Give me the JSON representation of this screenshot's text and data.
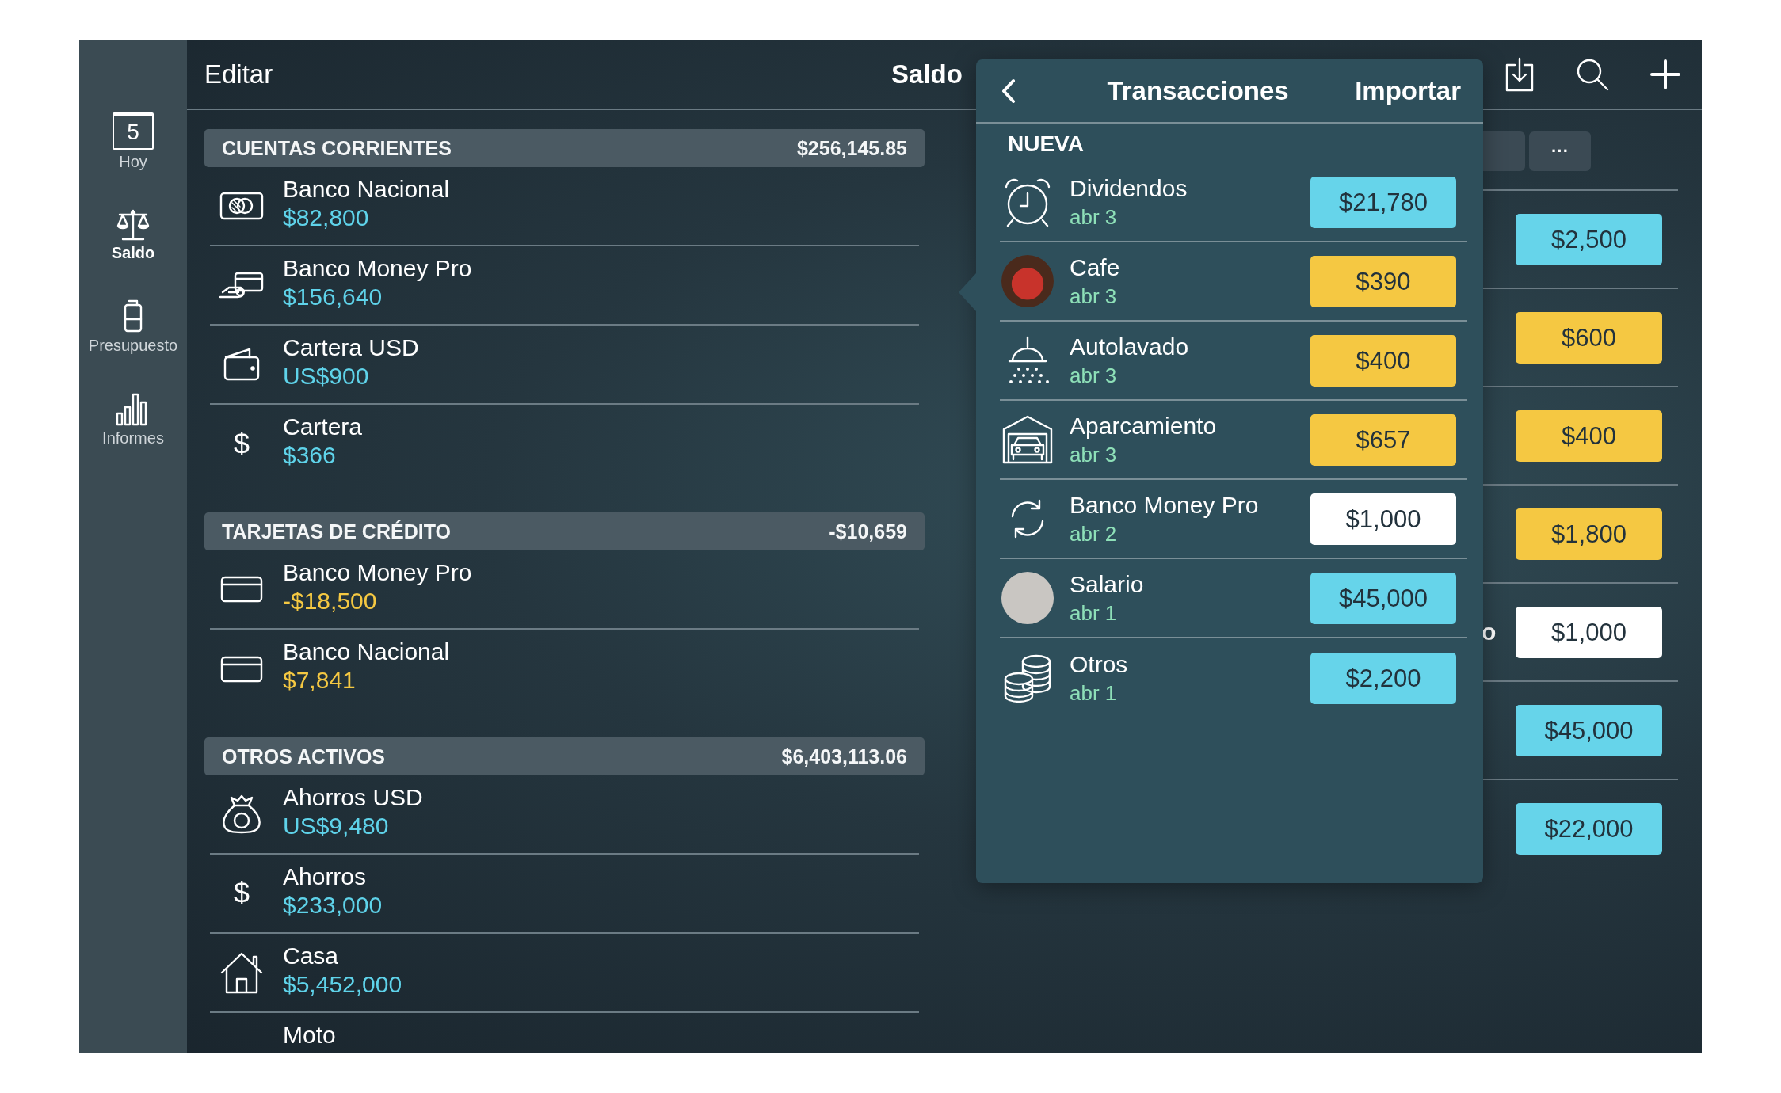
{
  "sidebar": {
    "items": [
      {
        "label": "Hoy",
        "kind": "calendar",
        "day": "5",
        "selected": false
      },
      {
        "label": "Saldo",
        "kind": "scales",
        "selected": true
      },
      {
        "label": "Presupuesto",
        "kind": "budget",
        "selected": false
      },
      {
        "label": "Informes",
        "kind": "bars",
        "selected": false
      }
    ]
  },
  "toolbar": {
    "edit": "Editar",
    "title": "Saldo"
  },
  "sections": [
    {
      "title": "CUENTAS CORRIENTES",
      "total": "$256,145.85",
      "accounts": [
        {
          "name": "Banco Nacional",
          "balance": "$82,800",
          "color": "#5fd3ea",
          "kind": "bank-card"
        },
        {
          "name": "Banco Money Pro",
          "balance": "$156,640",
          "color": "#5fd3ea",
          "kind": "card-hand"
        },
        {
          "name": "Cartera USD",
          "balance": "US$900",
          "color": "#5fd3ea",
          "kind": "wallet"
        },
        {
          "name": "Cartera",
          "balance": "$366",
          "color": "#5fd3ea",
          "kind": "symbol",
          "symbol": "$"
        }
      ]
    },
    {
      "title": "TARJETAS DE CRÉDITO",
      "total": "-$10,659",
      "accounts": [
        {
          "name": "Banco Money Pro",
          "balance": "-$18,500",
          "color": "#f5c842",
          "kind": "credit-card"
        },
        {
          "name": "Banco Nacional",
          "balance": "$7,841",
          "color": "#f5c842",
          "kind": "credit-card"
        }
      ]
    },
    {
      "title": "OTROS ACTIVOS",
      "total": "$6,403,113.06",
      "accounts": [
        {
          "name": "Ahorros USD",
          "balance": "US$9,480",
          "color": "#5fd3ea",
          "kind": "moneybag"
        },
        {
          "name": "Ahorros",
          "balance": "$233,000",
          "color": "#5fd3ea",
          "kind": "symbol",
          "symbol": "$"
        },
        {
          "name": "Casa",
          "balance": "$5,452,000",
          "color": "#5fd3ea",
          "kind": "house"
        },
        {
          "name": "Moto"
        }
      ]
    }
  ],
  "popover": {
    "title": "Transacciones",
    "action": "Importar",
    "group": "NUEVA",
    "transactions": [
      {
        "name": "Dividendos",
        "date": "abr 3",
        "amount": "$21,780",
        "color": "#66d4ea",
        "kind": "alarm"
      },
      {
        "name": "Cafe",
        "date": "abr 3",
        "amount": "$390",
        "color": "#f5c842",
        "kind": "photo"
      },
      {
        "name": "Autolavado",
        "date": "abr 3",
        "amount": "$400",
        "color": "#f5c842",
        "kind": "shower"
      },
      {
        "name": "Aparcamiento",
        "date": "abr 3",
        "amount": "$657",
        "color": "#f5c842",
        "kind": "garage"
      },
      {
        "name": "Banco Money Pro",
        "date": "abr 2",
        "amount": "$1,000",
        "color": "#ffffff",
        "kind": "sync"
      },
      {
        "name": "Salario",
        "date": "abr 1",
        "amount": "$45,000",
        "color": "#66d4ea",
        "kind": "avatar"
      },
      {
        "name": "Otros",
        "date": "abr 1",
        "amount": "$2,200",
        "color": "#66d4ea",
        "kind": "coins"
      }
    ]
  },
  "right_column": {
    "more": "···",
    "rows": [
      {
        "amount": "$2,500",
        "color": "#66d4ea"
      },
      {
        "amount": "$600",
        "color": "#f5c842"
      },
      {
        "amount": "$400",
        "color": "#f5c842"
      },
      {
        "amount": "$1,800",
        "color": "#f5c842"
      },
      {
        "label": "o",
        "amount": "$1,000",
        "color": "#ffffff"
      },
      {
        "amount": "$45,000",
        "color": "#66d4ea"
      },
      {
        "amount": "$22,000",
        "color": "#66d4ea"
      }
    ]
  }
}
